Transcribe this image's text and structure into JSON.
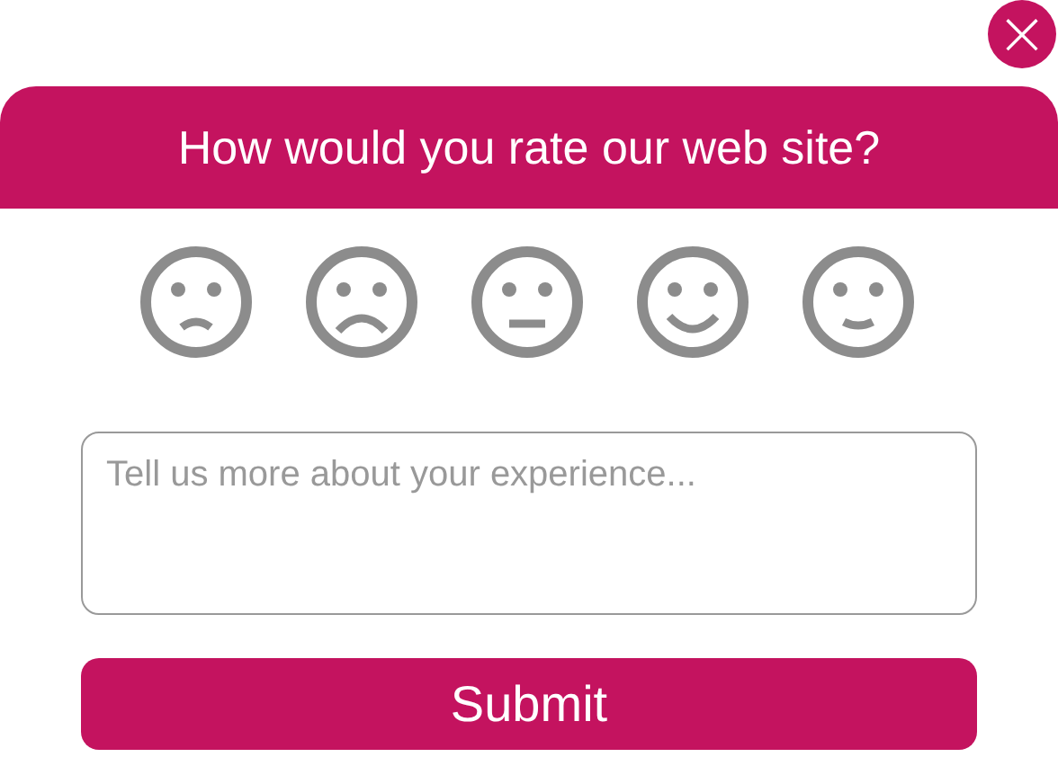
{
  "close_button": {
    "label": "×"
  },
  "header": {
    "title": "How would you rate our web site?"
  },
  "faces": [
    {
      "kind": "slight-frown"
    },
    {
      "kind": "frown"
    },
    {
      "kind": "neutral"
    },
    {
      "kind": "smile"
    },
    {
      "kind": "slight-smile"
    }
  ],
  "feedback": {
    "placeholder": "Tell us more about your experience..."
  },
  "submit_button": {
    "label": "Submit"
  }
}
